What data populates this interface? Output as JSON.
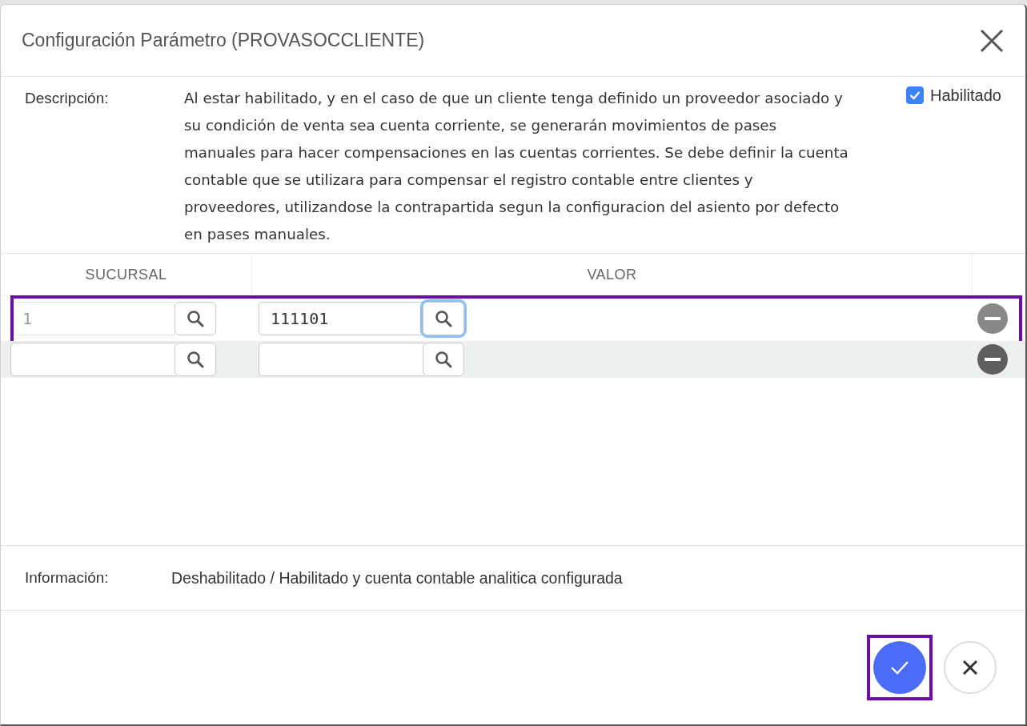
{
  "dialog": {
    "title": "Configuración Parámetro (PROVASOCCLIENTE)",
    "description_label": "Descripción:",
    "description": "Al estar habilitado, y en el caso de que un cliente tenga definido un proveedor asociado y su condición de venta sea cuenta corriente, se generarán movimientos de pases manuales para hacer compensaciones en las cuentas corrientes. Se debe definir la cuenta contable que se utilizara para compensar el registro contable entre clientes y proveedores, utilizandose la contrapartida segun la configuracion del asiento por defecto en pases manuales.",
    "enabled": {
      "label": "Habilitado",
      "checked": true
    },
    "table": {
      "columns": [
        "SUCURSAL",
        "VALOR"
      ],
      "rows": [
        {
          "sucursal": "1",
          "valor": "111101",
          "sucursal_disabled": true,
          "valor_lookup_focused": true,
          "hovered": false,
          "highlighted": true
        },
        {
          "sucursal_disabled": false,
          "valor_lookup_focused": false,
          "hovered": true,
          "highlighted": false
        }
      ]
    },
    "info_label": "Información:",
    "info": "Deshabilitado / Habilitado y cuenta contable analitica configurada",
    "buttons": [
      {
        "kind": "confirm",
        "highlighted": true
      },
      {
        "kind": "cancel",
        "highlighted": false
      }
    ]
  }
}
